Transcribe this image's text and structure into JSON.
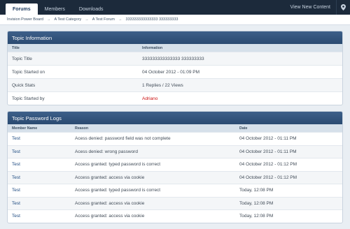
{
  "nav": {
    "tabs": [
      {
        "label": "Forums",
        "active": true
      },
      {
        "label": "Members",
        "active": false
      },
      {
        "label": "Downloads",
        "active": false
      }
    ],
    "view_new_content": "View New Content",
    "location_icon": "map-pin-icon"
  },
  "breadcrumb": {
    "items": [
      "Invision Power Board",
      "A Test Category",
      "A Test Forum",
      "333333333333333 333333333"
    ],
    "separator": "→"
  },
  "topic_info": {
    "title": "Topic Information",
    "columns": [
      "Title",
      "Information"
    ],
    "rows": [
      {
        "label": "Topic Title",
        "value": "333333333333333 333333333"
      },
      {
        "label": "Topic Started on",
        "value": "04 October 2012 - 01:09 PM"
      },
      {
        "label": "Quick Stats",
        "value": "1 Replies / 22 Views"
      },
      {
        "label": "Topic Started by",
        "value": "Adriano"
      }
    ]
  },
  "password_logs": {
    "title": "Topic Password Logs",
    "columns": [
      "Member Name",
      "Reason",
      "Date"
    ],
    "rows": [
      {
        "member": "Test",
        "reason": "Acess denied: password field was not complete",
        "date": "04 October 2012 - 01:11 PM"
      },
      {
        "member": "Test",
        "reason": "Acess denied: wrong password",
        "date": "04 October 2012 - 01:11 PM"
      },
      {
        "member": "Test",
        "reason": "Access granted: typed password is correct",
        "date": "04 October 2012 - 01:12 PM"
      },
      {
        "member": "Test",
        "reason": "Access granted: access via cookie",
        "date": "04 October 2012 - 01:12 PM"
      },
      {
        "member": "Test",
        "reason": "Access granted: typed password is correct",
        "date": "Today, 12:08 PM"
      },
      {
        "member": "Test",
        "reason": "Access granted: access via cookie",
        "date": "Today, 12:08 PM"
      },
      {
        "member": "Test",
        "reason": "Access granted: access via cookie",
        "date": "Today, 12:08 PM"
      }
    ]
  },
  "colors": {
    "topbar": "#1c2a3b",
    "panel_header": "#2b4a71",
    "link": "#1d4a80",
    "starter": "#cc1111"
  }
}
